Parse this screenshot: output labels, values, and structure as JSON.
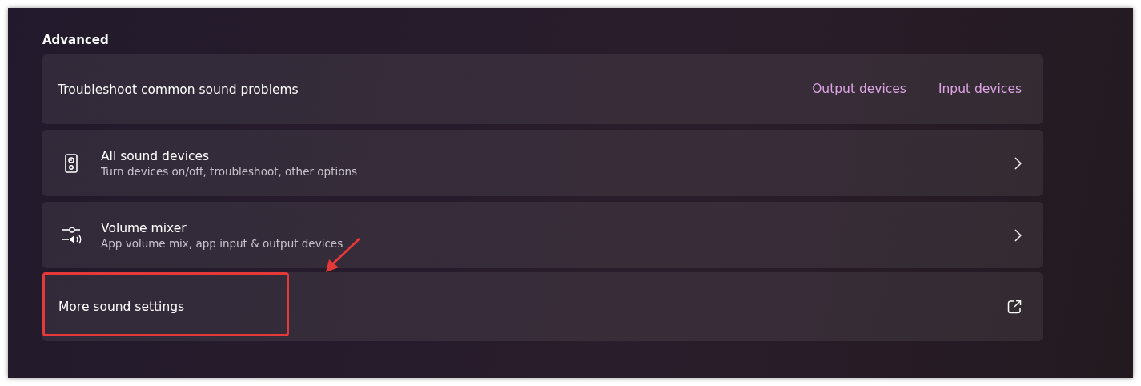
{
  "section": {
    "title": "Advanced"
  },
  "rows": [
    {
      "kind": "links",
      "title": "Troubleshoot common sound problems",
      "links": [
        "Output devices",
        "Input devices"
      ],
      "highlighted": false
    },
    {
      "kind": "devices",
      "title": "All sound devices",
      "subtitle": "Turn devices on/off, troubleshoot, other options",
      "highlighted": false
    },
    {
      "kind": "mixer",
      "title": "Volume mixer",
      "subtitle": "App volume mix, app input & output devices",
      "highlighted": false
    },
    {
      "kind": "external",
      "title": "More sound settings",
      "highlighted": true
    }
  ]
}
